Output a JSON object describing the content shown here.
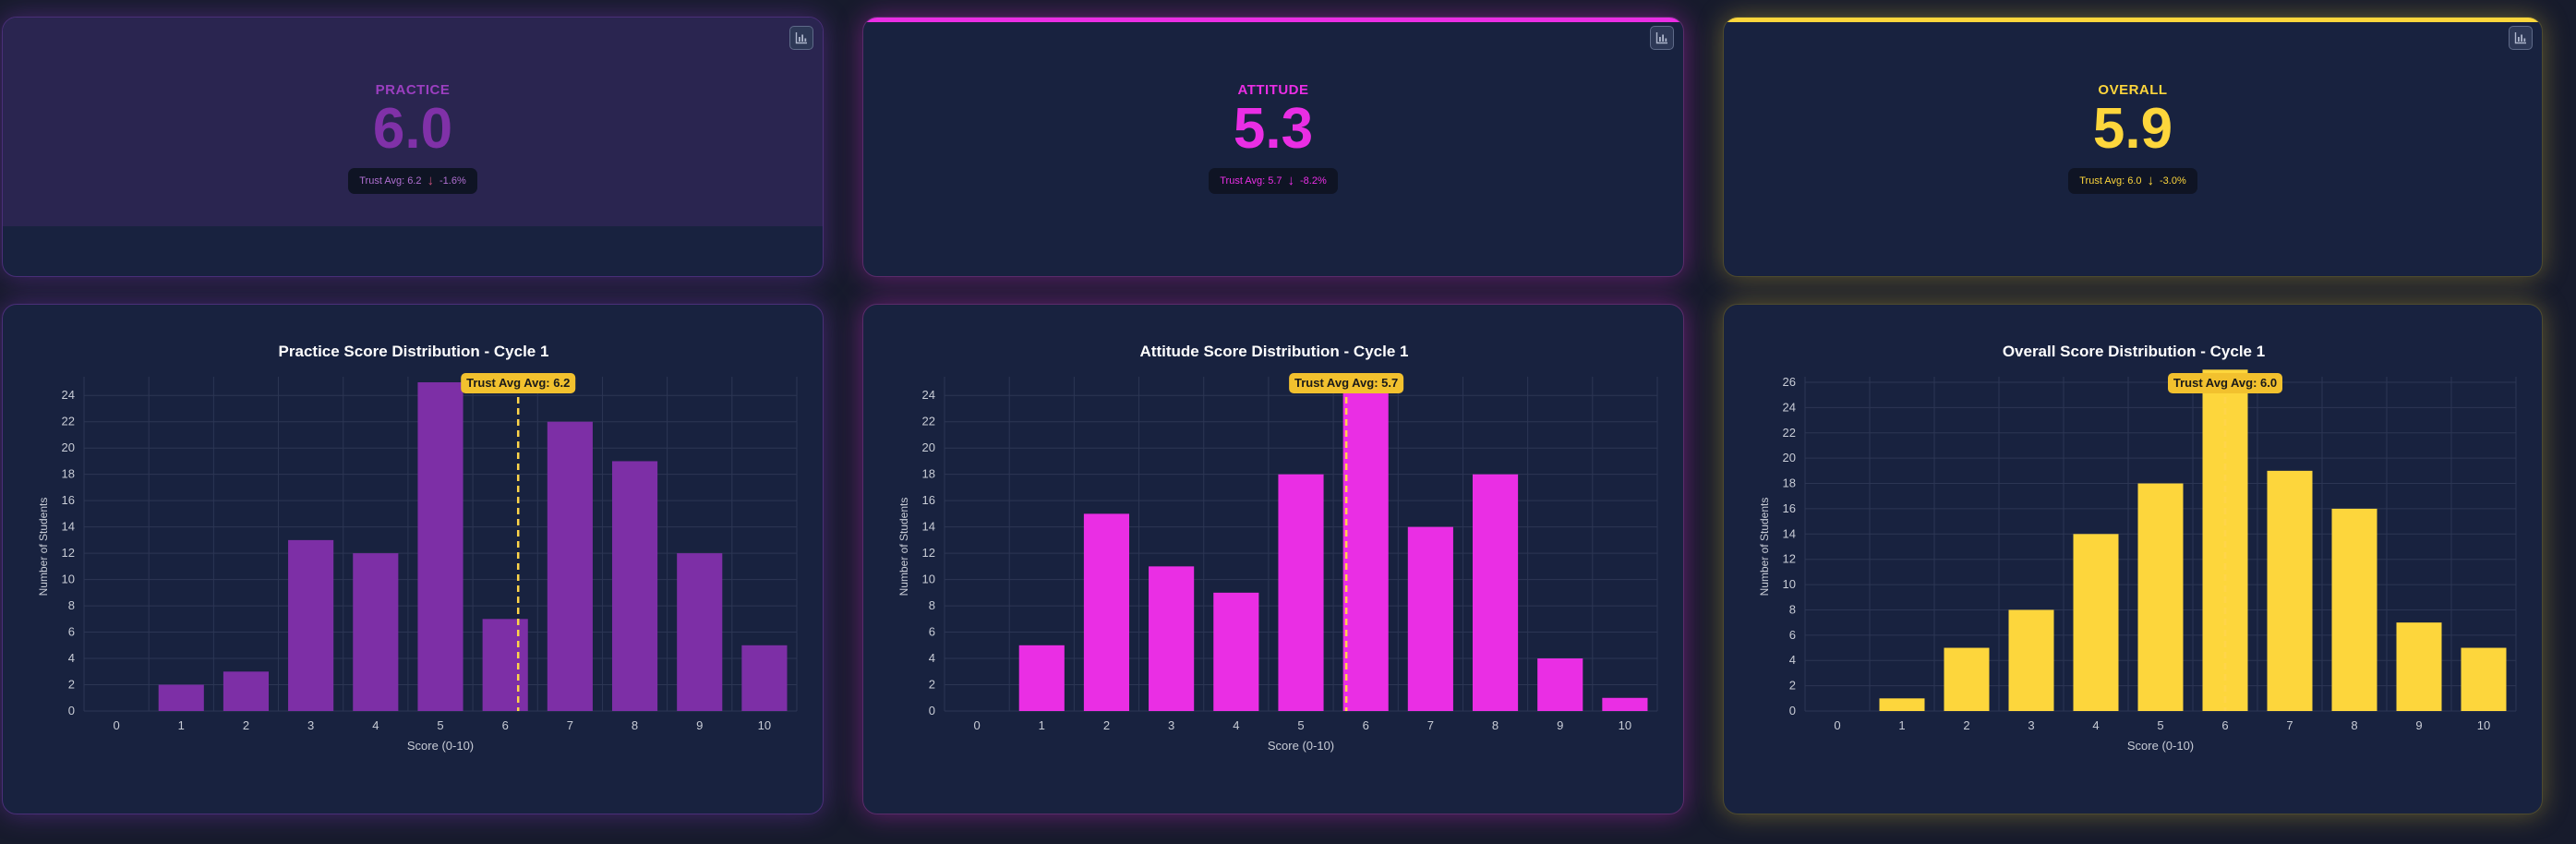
{
  "panels": [
    {
      "stat": {
        "label": "PRACTICE",
        "value": "6.0",
        "trust_avg": "Trust Avg: 6.2",
        "arrow": "↓",
        "change": "-1.6%"
      },
      "colors": {
        "accent": "#8031a8",
        "label": "#9b3fc0",
        "pill_text": "#b06fd1",
        "selected_band": "#2a2550"
      }
    },
    {
      "stat": {
        "label": "ATTITUDE",
        "value": "5.3",
        "trust_avg": "Trust Avg: 5.7",
        "arrow": "↓",
        "change": "-8.2%"
      },
      "colors": {
        "accent": "#ea2ee4",
        "label": "#ea2ee4",
        "pill_text": "#ea2ee4"
      }
    },
    {
      "stat": {
        "label": "OVERALL",
        "value": "5.9",
        "trust_avg": "Trust Avg: 6.0",
        "arrow": "↓",
        "change": "-3.0%"
      },
      "colors": {
        "accent": "#fdd63c",
        "label": "#fdd63c",
        "pill_text": "#fdd63c"
      }
    }
  ],
  "icons": {
    "chart_toggle": "bar-chart-icon",
    "trend_down": "arrow-down-icon"
  },
  "colors": {
    "avg_line": "#ffd54a",
    "avg_badge_bg": "#f2c12e",
    "axis_text": "#c8ccd6",
    "grid": "#2c3654"
  },
  "chart_data": [
    {
      "type": "bar",
      "title": "Practice Score Distribution - Cycle 1",
      "xlabel": "Score (0-10)",
      "ylabel": "Number of Students",
      "categories": [
        "0",
        "1",
        "2",
        "3",
        "4",
        "5",
        "6",
        "7",
        "8",
        "9",
        "10"
      ],
      "values": [
        0,
        2,
        3,
        13,
        12,
        25,
        7,
        22,
        19,
        12,
        5
      ],
      "ylim": [
        0,
        25
      ],
      "yticks": [
        0,
        2,
        4,
        6,
        8,
        10,
        12,
        14,
        16,
        18,
        20,
        22,
        24
      ],
      "bar_color": "#7d2fa6",
      "avg_line": {
        "x": 6.2,
        "label": "Trust Avg Avg: 6.2"
      },
      "grid": true
    },
    {
      "type": "bar",
      "title": "Attitude Score Distribution - Cycle 1",
      "xlabel": "Score (0-10)",
      "ylabel": "Number of Students",
      "categories": [
        "0",
        "1",
        "2",
        "3",
        "4",
        "5",
        "6",
        "7",
        "8",
        "9",
        "10"
      ],
      "values": [
        0,
        5,
        15,
        11,
        9,
        18,
        25,
        14,
        18,
        4,
        1
      ],
      "ylim": [
        0,
        25
      ],
      "yticks": [
        0,
        2,
        4,
        6,
        8,
        10,
        12,
        14,
        16,
        18,
        20,
        22,
        24
      ],
      "bar_color": "#ea2ee4",
      "avg_line": {
        "x": 5.7,
        "label": "Trust Avg Avg: 5.7"
      },
      "grid": true
    },
    {
      "type": "bar",
      "title": "Overall Score Distribution - Cycle 1",
      "xlabel": "Score (0-10)",
      "ylabel": "Number of Students",
      "categories": [
        "0",
        "1",
        "2",
        "3",
        "4",
        "5",
        "6",
        "7",
        "8",
        "9",
        "10"
      ],
      "values": [
        0,
        1,
        5,
        8,
        14,
        18,
        27,
        19,
        16,
        7,
        5
      ],
      "ylim": [
        0,
        26
      ],
      "yticks": [
        0,
        2,
        4,
        6,
        8,
        10,
        12,
        14,
        16,
        18,
        20,
        22,
        24,
        26
      ],
      "bar_color": "#fdd63c",
      "avg_line": {
        "x": 6.0,
        "label": "Trust Avg Avg: 6.0"
      },
      "grid": true
    }
  ]
}
